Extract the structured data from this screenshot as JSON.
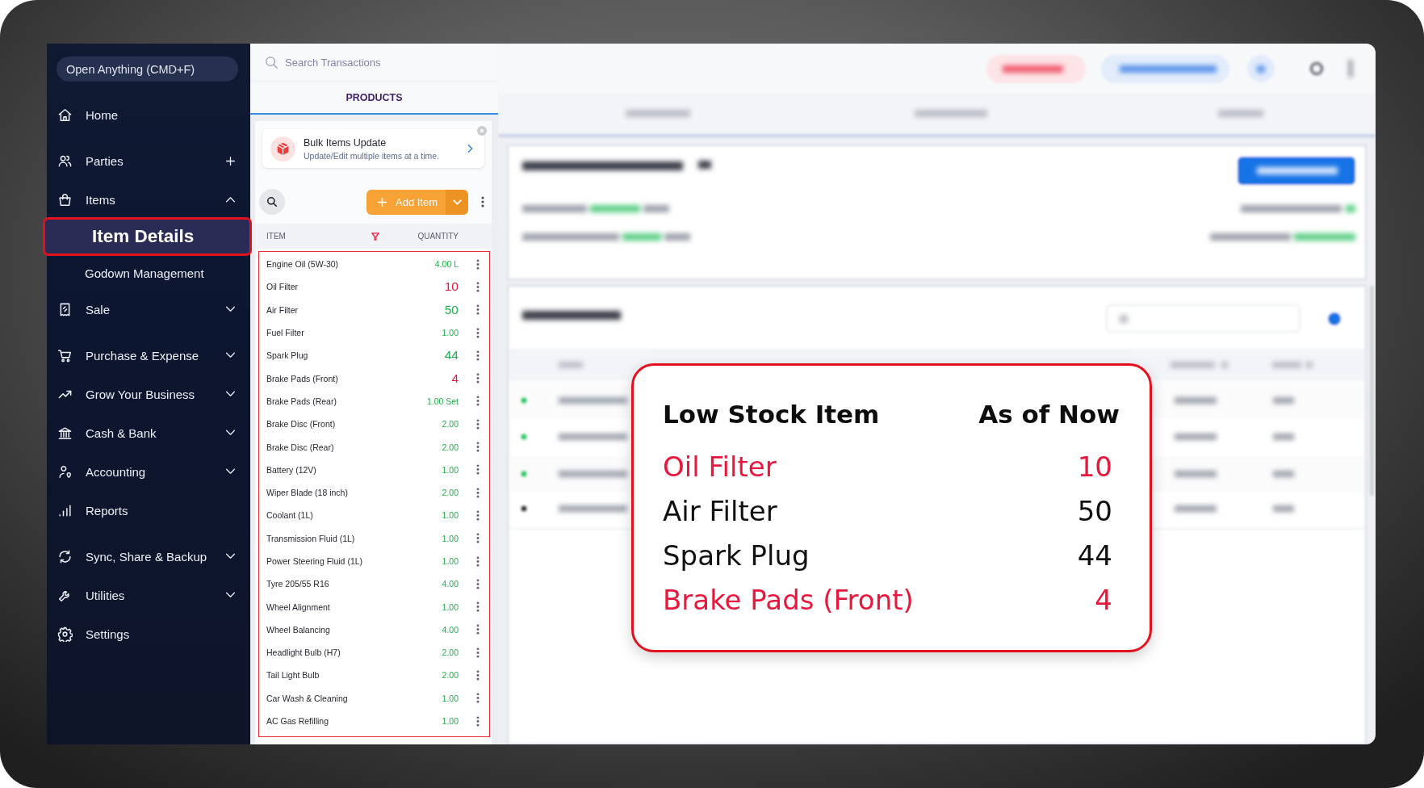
{
  "sidebar": {
    "search": {
      "placeholder": "Open Anything (CMD+F)"
    },
    "items": [
      {
        "label": "Home",
        "kind": "link",
        "selected": false
      },
      {
        "label": "Parties",
        "kind": "add",
        "selected": false
      },
      {
        "label": "Items",
        "kind": "group",
        "expanded": true,
        "selected": false,
        "children": [
          {
            "label": "Item Details",
            "selected": true
          },
          {
            "label": "Godown Management",
            "selected": false
          }
        ]
      },
      {
        "label": "Sale",
        "kind": "group",
        "expanded": false,
        "selected": false
      },
      {
        "label": "Purchase & Expense",
        "kind": "group",
        "expanded": false,
        "selected": false
      },
      {
        "label": "Grow Your Business",
        "kind": "group",
        "expanded": false,
        "selected": false
      },
      {
        "label": "Cash & Bank",
        "kind": "group",
        "expanded": false,
        "selected": false
      },
      {
        "label": "Accounting",
        "kind": "group",
        "expanded": false,
        "selected": false
      },
      {
        "label": "Reports",
        "kind": "link",
        "selected": false
      },
      {
        "label": "Sync, Share & Backup",
        "kind": "group",
        "expanded": false,
        "selected": false
      },
      {
        "label": "Utilities",
        "kind": "group",
        "expanded": false,
        "selected": false
      },
      {
        "label": "Settings",
        "kind": "link",
        "selected": false
      }
    ]
  },
  "products_panel": {
    "search": {
      "placeholder": "Search Transactions"
    },
    "tabs": [
      {
        "label": "PRODUCTS",
        "selected": true
      }
    ],
    "banner": {
      "title": "Bulk Items Update",
      "subtitle": "Update/Edit multiple items at a time."
    },
    "add_button": {
      "label": "Add Item"
    },
    "columns": [
      "ITEM",
      "QUANTITY"
    ],
    "filter_active": true,
    "items": [
      {
        "name": "Engine Oil (5W-30)",
        "quantity": "4.00 L",
        "low_stock": false,
        "emphasized": false
      },
      {
        "name": "Oil Filter",
        "quantity": "10",
        "low_stock": true,
        "emphasized": true
      },
      {
        "name": "Air Filter",
        "quantity": "50",
        "low_stock": false,
        "emphasized": true
      },
      {
        "name": "Fuel Filter",
        "quantity": "1.00",
        "low_stock": false,
        "emphasized": false
      },
      {
        "name": "Spark Plug",
        "quantity": "44",
        "low_stock": false,
        "emphasized": true
      },
      {
        "name": "Brake Pads (Front)",
        "quantity": "4",
        "low_stock": true,
        "emphasized": true
      },
      {
        "name": "Brake Pads (Rear)",
        "quantity": "1.00 Set",
        "low_stock": false,
        "emphasized": false
      },
      {
        "name": "Brake Disc (Front)",
        "quantity": "2.00",
        "low_stock": false,
        "emphasized": false
      },
      {
        "name": "Brake Disc (Rear)",
        "quantity": "2.00",
        "low_stock": false,
        "emphasized": false
      },
      {
        "name": "Battery (12V)",
        "quantity": "1.00",
        "low_stock": false,
        "emphasized": false
      },
      {
        "name": "Wiper Blade (18 inch)",
        "quantity": "2.00",
        "low_stock": false,
        "emphasized": false
      },
      {
        "name": "Coolant (1L)",
        "quantity": "1.00",
        "low_stock": false,
        "emphasized": false
      },
      {
        "name": "Transmission Fluid (1L)",
        "quantity": "1.00",
        "low_stock": false,
        "emphasized": false
      },
      {
        "name": "Power Steering Fluid (1L)",
        "quantity": "1.00",
        "low_stock": false,
        "emphasized": false
      },
      {
        "name": "Tyre 205/55 R16",
        "quantity": "4.00",
        "low_stock": false,
        "emphasized": false
      },
      {
        "name": "Wheel Alignment",
        "quantity": "1.00",
        "low_stock": false,
        "emphasized": false
      },
      {
        "name": "Wheel Balancing",
        "quantity": "4.00",
        "low_stock": false,
        "emphasized": false
      },
      {
        "name": "Headlight Bulb (H7)",
        "quantity": "2.00",
        "low_stock": false,
        "emphasized": false
      },
      {
        "name": "Tail Light Bulb",
        "quantity": "2.00",
        "low_stock": false,
        "emphasized": false
      },
      {
        "name": "Car Wash & Cleaning",
        "quantity": "1.00",
        "low_stock": false,
        "emphasized": false
      },
      {
        "name": "AC Gas Refilling",
        "quantity": "1.00",
        "low_stock": false,
        "emphasized": false
      }
    ]
  },
  "low_stock_popup": {
    "title": "Low Stock Item",
    "as_of": "As of Now",
    "items": [
      {
        "name": "Oil Filter",
        "quantity": "10",
        "low_stock": true
      },
      {
        "name": "Air Filter",
        "quantity": "50",
        "low_stock": false
      },
      {
        "name": "Spark Plug",
        "quantity": "44",
        "low_stock": false
      },
      {
        "name": "Brake Pads (Front)",
        "quantity": "4",
        "low_stock": true
      }
    ]
  }
}
